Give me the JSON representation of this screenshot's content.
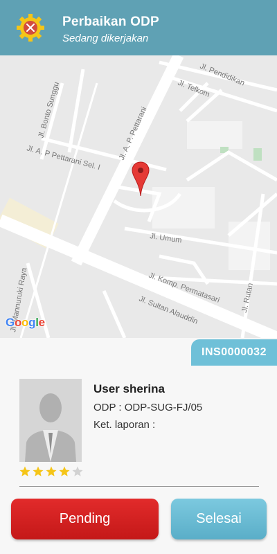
{
  "header": {
    "title": "Perbaikan ODP",
    "subtitle": "Sedang dikerjakan",
    "icon": "gear-wrench-icon",
    "color": "#5fa1b4"
  },
  "map": {
    "streets": [
      "Jl. Bonto Sunggu",
      "Jl. Telkom",
      "Jl. Pendidikan",
      "Jl. A. P. Pettarani",
      "Jl. A. P Pettarani Sel. I",
      "Jl. Umum",
      "Jl. Komp. Permatasari",
      "Jl. Sultan Alauddin",
      "Jl. Rutan",
      "Jl. Mannuruki Raya"
    ],
    "marker": "map-pin-icon",
    "logo": "Google"
  },
  "ticket": {
    "id": "INS0000032"
  },
  "user": {
    "name": "User sherina",
    "odp_label": "ODP : ODP-SUG-FJ/05",
    "report_label": "Ket. laporan :",
    "rating": 4,
    "rating_max": 5
  },
  "actions": {
    "pending_label": "Pending",
    "selesai_label": "Selesai",
    "pending_color": "#d92020",
    "selesai_color": "#6cbcd5"
  }
}
